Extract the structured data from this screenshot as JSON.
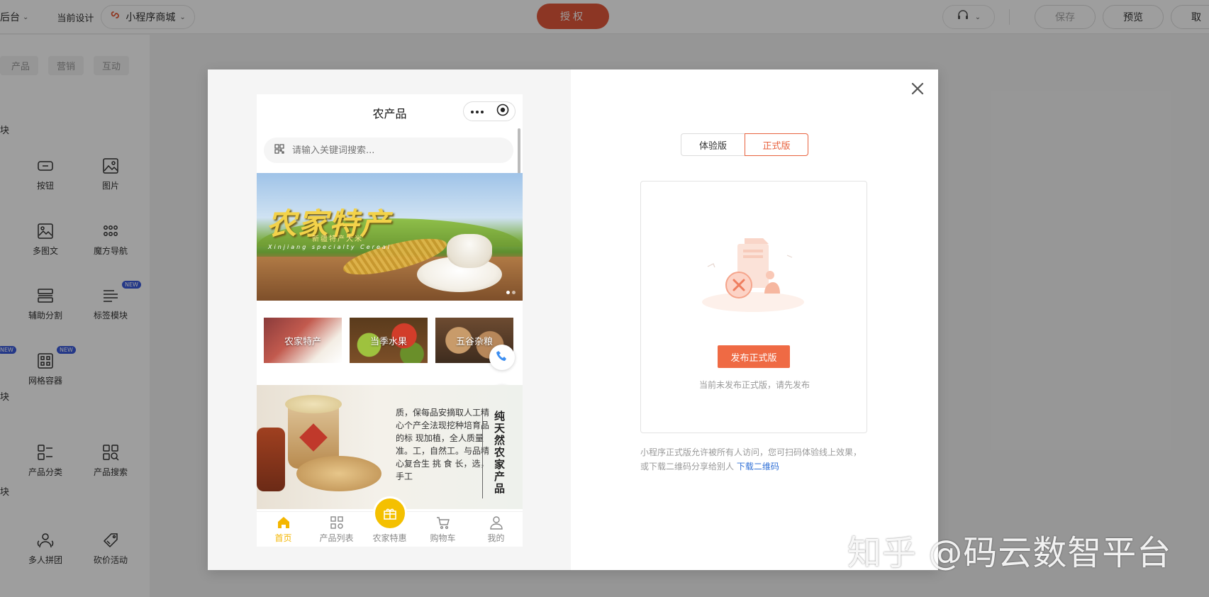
{
  "topbar": {
    "backend_label": "后台",
    "current_design_label": "当前设计",
    "app_select_value": "小程序商城",
    "authorize_label": "授权",
    "save_label": "保存",
    "preview_label": "预览",
    "extra_label": "取"
  },
  "sidebar": {
    "tabs": [
      "产品",
      "营销",
      "互动"
    ],
    "section_labels": [
      "块",
      "块",
      "块"
    ],
    "items": [
      {
        "label": "按钮",
        "icon": "button-icon"
      },
      {
        "label": "图片",
        "icon": "image-icon"
      },
      {
        "label": "多图文",
        "icon": "multi-image-text-icon"
      },
      {
        "label": "魔方导航",
        "icon": "grid-dots-icon"
      },
      {
        "label": "辅助分割",
        "icon": "divider-icon"
      },
      {
        "label": "标签模块",
        "icon": "tag-list-icon"
      },
      {
        "label": "网格容器",
        "icon": "grid-container-icon"
      },
      {
        "label": "产品分类",
        "icon": "category-icon"
      },
      {
        "label": "产品搜索",
        "icon": "product-search-icon"
      },
      {
        "label": "多人拼团",
        "icon": "group-buy-icon"
      },
      {
        "label": "砍价活动",
        "icon": "bargain-icon"
      }
    ],
    "new_badge": "NEW"
  },
  "phone": {
    "title": "农产品",
    "search_placeholder": "请输入关键词搜索...",
    "banner": {
      "title": "农家特产",
      "subtitle": "新疆特产大米",
      "english": "Xinjiang specialty Cereal"
    },
    "categories": [
      "农家特产",
      "当季水果",
      "五谷杂粮"
    ],
    "promo": {
      "text": "质，保每品安摘取人工精心个产全法现挖种培育品的标 现加植，全人质量准。工，自然工。与品精心复合生 挑 食 长，选， 手工",
      "vertical_title": "纯天然农家产品"
    },
    "nav": [
      {
        "label": "首页",
        "icon": "home-icon",
        "active": true
      },
      {
        "label": "产品列表",
        "icon": "product-list-icon",
        "active": false
      },
      {
        "label": "农家特惠",
        "icon": "gift-icon",
        "active": false
      },
      {
        "label": "购物车",
        "icon": "cart-icon",
        "active": false
      },
      {
        "label": "我的",
        "icon": "user-icon",
        "active": false
      }
    ]
  },
  "publish": {
    "tab_trial": "体验版",
    "tab_official": "正式版",
    "publish_button": "发布正式版",
    "hint": "当前未发布正式版，请先发布",
    "note_text": "小程序正式版允许被所有人访问，您可扫码体验线上效果，或下载二维码分享给别人",
    "note_link": "下载二维码"
  },
  "watermark": "知乎 @码云数智平台",
  "colors": {
    "accent": "#e2583b",
    "publish": "#ef6a44",
    "nav_active": "#f4b600",
    "link": "#2f6fd6"
  }
}
